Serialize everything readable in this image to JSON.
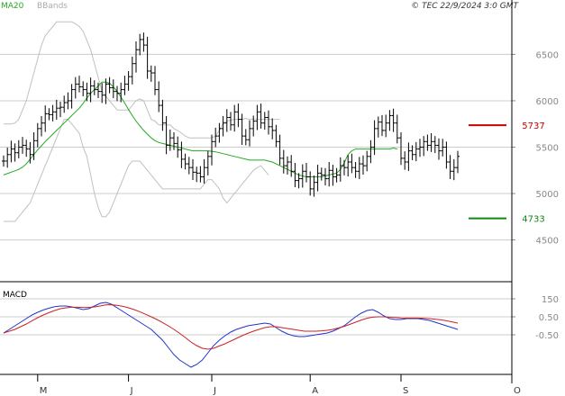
{
  "header": {
    "ma_label": "MA20",
    "bb_label": "BBands",
    "source": "© TEC 22/9/2024 3:0 GMT"
  },
  "macd_label": "MACD",
  "colors": {
    "bar": "#000000",
    "ma20": "#22aa22",
    "bbands": "#c0c0c0",
    "grid": "#cccccc",
    "macd": "#2233cc",
    "signal": "#cc2222",
    "resistance": "#cc0000",
    "support": "#118811"
  },
  "chart_data": [
    {
      "type": "ohlc",
      "yticks": [
        4500,
        5000,
        5500,
        6000,
        6500
      ],
      "ytick_labels": [
        "4500",
        "5000",
        "5500",
        "6000",
        "6500"
      ],
      "ylim": [
        4050,
        6950
      ],
      "xlim": [
        0,
        134
      ],
      "x_labels": [
        {
          "label": "M",
          "index": 9
        },
        {
          "label": "J",
          "index": 33
        },
        {
          "label": "J",
          "index": 55
        },
        {
          "label": "A",
          "index": 81
        },
        {
          "label": "S",
          "index": 105
        },
        {
          "label": "O",
          "index": 134
        }
      ],
      "closes": [
        5350,
        5420,
        5480,
        5440,
        5500,
        5520,
        5480,
        5420,
        5570,
        5700,
        5760,
        5860,
        5850,
        5880,
        5920,
        5930,
        5980,
        6000,
        6120,
        6180,
        6150,
        6120,
        6080,
        6160,
        6120,
        6100,
        6060,
        6180,
        6140,
        6100,
        6080,
        6120,
        6180,
        6260,
        6400,
        6550,
        6660,
        6600,
        6320,
        6300,
        6120,
        5950,
        5760,
        5520,
        5600,
        5540,
        5470,
        5370,
        5320,
        5280,
        5230,
        5220,
        5180,
        5280,
        5400,
        5560,
        5620,
        5700,
        5760,
        5820,
        5740,
        5880,
        5800,
        5620,
        5580,
        5700,
        5780,
        5880,
        5760,
        5820,
        5720,
        5680,
        5560,
        5380,
        5300,
        5340,
        5240,
        5140,
        5160,
        5240,
        5180,
        5050,
        5120,
        5220,
        5200,
        5160,
        5250,
        5180,
        5200,
        5300,
        5280,
        5340,
        5280,
        5240,
        5320,
        5300,
        5400,
        5500,
        5700,
        5770,
        5680,
        5760,
        5840,
        5760,
        5600,
        5380,
        5340,
        5460,
        5420,
        5480,
        5500,
        5560,
        5520,
        5560,
        5520,
        5460,
        5500,
        5340,
        5240,
        5280,
        5400
      ],
      "ma20": [
        5200,
        5215,
        5230,
        5245,
        5260,
        5285,
        5320,
        5370,
        5420,
        5470,
        5515,
        5560,
        5600,
        5640,
        5680,
        5720,
        5760,
        5800,
        5840,
        5880,
        5920,
        5970,
        6030,
        6080,
        6120,
        6160,
        6200,
        6200,
        6190,
        6150,
        6100,
        6040,
        5975,
        5905,
        5840,
        5780,
        5730,
        5680,
        5640,
        5600,
        5570,
        5550,
        5540,
        5530,
        5520,
        5510,
        5500,
        5490,
        5480,
        5470,
        5460,
        5460,
        5460,
        5460,
        5460,
        5455,
        5450,
        5440,
        5430,
        5420,
        5410,
        5400,
        5390,
        5380,
        5370,
        5360,
        5360,
        5360,
        5360,
        5360,
        5350,
        5340,
        5320,
        5300,
        5280,
        5260,
        5240,
        5220,
        5200,
        5190,
        5180,
        5180,
        5180,
        5180,
        5180,
        5190,
        5200,
        5210,
        5220,
        5260,
        5330,
        5420,
        5460,
        5480,
        5480,
        5480,
        5480,
        5480,
        5480,
        5480,
        5480,
        5480,
        5480,
        5490,
        5480
      ],
      "bb_upper": [
        5750,
        5750,
        5750,
        5760,
        5800,
        5900,
        6000,
        6150,
        6300,
        6450,
        6600,
        6700,
        6750,
        6800,
        6850,
        6850,
        6850,
        6850,
        6850,
        6830,
        6800,
        6750,
        6650,
        6550,
        6400,
        6250,
        6100,
        6050,
        6000,
        5950,
        5900,
        5900,
        5900,
        5900,
        5950,
        6000,
        6020,
        6000,
        5900,
        5800,
        5780,
        5740,
        5740,
        5740,
        5740,
        5700,
        5680,
        5650,
        5620,
        5600,
        5600,
        5600,
        5600,
        5600,
        5600,
        5600,
        5620,
        5680,
        5760,
        5780,
        5790,
        5800,
        5800,
        5800,
        5810,
        5800,
        5800,
        5800,
        5800,
        5800,
        5800,
        5800,
        5800,
        5800
      ],
      "bb_lower": [
        4700,
        4700,
        4700,
        4700,
        4750,
        4800,
        4850,
        4900,
        5000,
        5100,
        5200,
        5300,
        5400,
        5500,
        5600,
        5700,
        5800,
        5800,
        5750,
        5700,
        5650,
        5500,
        5400,
        5200,
        5000,
        4850,
        4750,
        4750,
        4800,
        4900,
        5000,
        5100,
        5200,
        5300,
        5350,
        5350,
        5350,
        5300,
        5250,
        5200,
        5150,
        5100,
        5050,
        5050,
        5050,
        5050,
        5050,
        5050,
        5050,
        5050,
        5050,
        5050,
        5050,
        5100,
        5150,
        5150,
        5100,
        5050,
        4950,
        4900,
        4950,
        5000,
        5050,
        5100,
        5150,
        5200,
        5250,
        5280,
        5300,
        5250,
        5200
      ],
      "levels": [
        {
          "label": "5737",
          "value": 5737,
          "kind": "resistance"
        },
        {
          "label": "4733",
          "value": 4733,
          "kind": "support"
        }
      ]
    },
    {
      "type": "line",
      "name": "MACD",
      "yticks": [
        150,
        50,
        -50
      ],
      "ytick_labels": [
        "150",
        "0.50",
        "-0.50"
      ],
      "ylim": [
        -270,
        230
      ],
      "macd": [
        -40,
        -20,
        0,
        20,
        40,
        60,
        75,
        88,
        98,
        106,
        110,
        110,
        105,
        98,
        90,
        95,
        110,
        125,
        130,
        120,
        100,
        80,
        60,
        40,
        20,
        0,
        -20,
        -50,
        -80,
        -120,
        -160,
        -190,
        -210,
        -230,
        -215,
        -190,
        -150,
        -110,
        -80,
        -55,
        -35,
        -20,
        -10,
        0,
        5,
        10,
        15,
        10,
        -10,
        -30,
        -45,
        -55,
        -60,
        -60,
        -55,
        -50,
        -45,
        -40,
        -30,
        -15,
        0,
        25,
        50,
        70,
        85,
        90,
        75,
        55,
        40,
        35,
        35,
        40,
        40,
        40,
        35,
        30,
        20,
        10,
        0,
        -10,
        -20
      ],
      "signal": [
        -40,
        -30,
        -20,
        -5,
        10,
        28,
        45,
        60,
        73,
        85,
        95,
        100,
        103,
        103,
        102,
        102,
        105,
        110,
        116,
        117,
        114,
        108,
        100,
        90,
        78,
        64,
        50,
        35,
        18,
        0,
        -20,
        -42,
        -65,
        -90,
        -110,
        -125,
        -130,
        -125,
        -112,
        -100,
        -85,
        -70,
        -55,
        -42,
        -30,
        -20,
        -10,
        -5,
        -5,
        -10,
        -15,
        -20,
        -25,
        -30,
        -30,
        -30,
        -28,
        -25,
        -20,
        -12,
        -3,
        8,
        20,
        32,
        42,
        48,
        50,
        50,
        48,
        46,
        44,
        43,
        43,
        43,
        42,
        40,
        37,
        33,
        28,
        22,
        15
      ],
      "x_labels": [
        {
          "label": "M",
          "index": 9
        },
        {
          "label": "J",
          "index": 33
        },
        {
          "label": "J",
          "index": 55
        },
        {
          "label": "A",
          "index": 81
        },
        {
          "label": "S",
          "index": 105
        },
        {
          "label": "O",
          "index": 134
        }
      ]
    }
  ]
}
